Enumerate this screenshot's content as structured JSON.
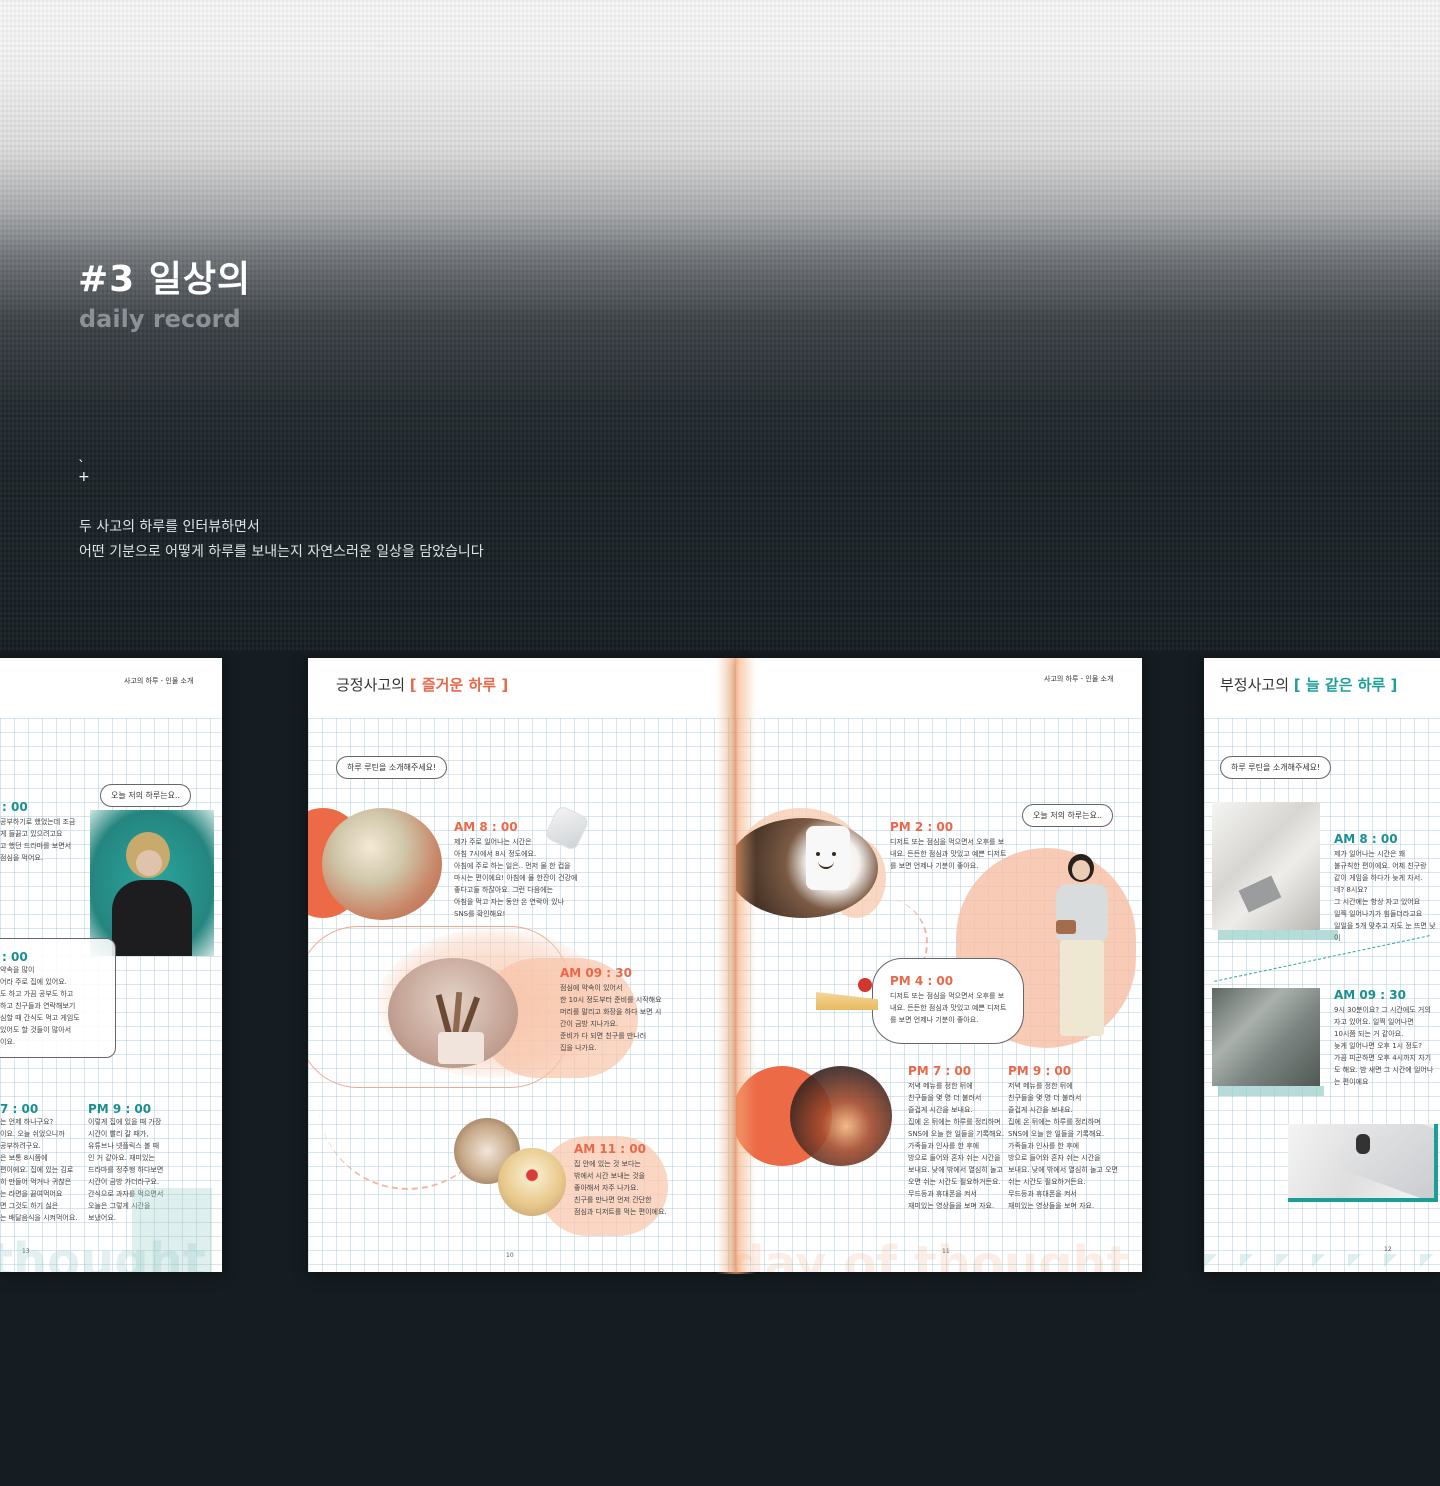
{
  "hero": {
    "title": "#3 일상의",
    "subtitle": "daily record",
    "description_line1": "두 사고의 하루를 인터뷰하면서",
    "description_line2": "어떤 기분으로 어떻게 하루를 보내는지 자연스러운 일상을 담았습니다"
  },
  "left_page": {
    "running_head": "사고의 하루 - 인물 소개",
    "bubble": "오늘 저의 하루는요..",
    "time1": ": 00",
    "text1": "공부하기로 했었는데 조금\n게 들끓고 있으려고요\n고 했던 드라마를 보면서\n점심을 먹어요.",
    "time2": ": 00",
    "text2": "약속을 많이\n어라 주로 집에 있어요.\n도 하고 가끔 공부도 하고\n하고 친구들과 연락해보기\n심할 때 간식도 먹고 게임도\n있어도 할 것들이 많아서\n이요.",
    "time3": "7 : 00",
    "text3": "는 언제 하나구요?\n이요. 오늘 쉬었으니까\n공부하려구요.\n은 보통 8시쯤에\n편이에요. 집에 있는 김로\n히 만들어 먹거나 귀찮은\n는 라면을 끓여먹어요\n면 그것도 하기 싫은\n는 배달음식을 시켜먹어요.",
    "time4": "PM 9 : 00",
    "text4": "이렇게 집에 있을 때 가장\n시간이 빨리 갈 때가,\n유튜브나 넷플릭스 볼 때\n인 거 같아요. 재미있는\n드라마를 정주행 하다보면\n시간이 금방 가더라구요.\n간식으로 과자를 먹으면서\n오늘은 그렇게 시간을\n보냈어요.",
    "page_number": "13",
    "watermark": "thought"
  },
  "spread_left": {
    "heading_prefix": "긍정사고의",
    "heading_bracket": "[ 즐거운 하루 ]",
    "bubble": "하루 루틴을 소개해주세요!",
    "entries": [
      {
        "time": "AM 8 : 00",
        "text": "제가 주로 일어나는 시간은\n아침 7시에서 8시 정도에요.\n아침에 주로 하는 일은.. 먼저 물 한 컵을\n마시는 편이에요! 아침에 물 한잔이 건강에\n좋다고들 하잖아요. 그런 다음에는\n아침을 먹고 자는 동안 온 연락이 있나\nSNS를 확인해요!"
      },
      {
        "time": "AM 09 : 30",
        "text": "점심에 약속이 있어서\n한 10시 정도부터 준비를 시작해요\n머리를 말리고 화장을 하다 보면 시\n간이 금방 지나가요.\n준비가 다 되면 친구를 만나러\n집을 나가요."
      },
      {
        "time": "AM 11 : 00",
        "text": "집 안에 있는 것 보다는\n밖에서 시간 보내는 것을\n좋아해서 자주 나가요.\n친구를 만나면 먼저 간단한\n점심과 디저트를 먹는 편이에요."
      }
    ],
    "page_number": "10"
  },
  "spread_right": {
    "running_head": "사고의 하루 - 인물 소개",
    "bubble": "오늘 저의 하루는요..",
    "entries": [
      {
        "time": "PM 2 : 00",
        "text": "디저트 또는 점심을 먹으면서 오후를 보\n내요. 든든한 점심과 맛있고 예쁜 디저트\n를 보면 언제나 기분이 좋아요."
      },
      {
        "time": "PM 4 : 00",
        "text": "디저트 또는 점심을 먹으면서 오후를 보\n내요. 든든한 점심과 맛있고 예쁜 디저트\n를 보면 언제나 기분이 좋아요."
      },
      {
        "time": "PM 7 : 00",
        "text": "저녁 메뉴를 정한 뒤에\n친구들을 몇 명 더 불러서\n즐겁게 시간을 보내요.\n집에 온 뒤에는 하루를 정리하며\nSNS에 오늘 한 일들을 기록해요.\n가족들과 인사를 한 후에\n방으로 들어와 혼자 쉬는 시간을\n보내요. 낮에 밖에서 열심히 놀고\n오면 쉬는 시간도 필요하거든요.\n무드등과 휴대폰을 켜서\n재미있는 영상들을 보며 자요."
      },
      {
        "time": "PM 9 : 00",
        "text": "저녁 메뉴를 정한 뒤에\n친구들을 몇 명 더 불러서\n즐겁게 시간을 보내요.\n집에 온 뒤에는 하루를 정리하며\nSNS에 오늘 한 일들을 기록해요.\n가족들과 인사를 한 후에\n방으로 들어와 혼자 쉬는 시간을\n보내요. 낮에 밖에서 열심히 놀고 오면\n쉬는 시간도 필요하거든요.\n무드등과 휴대폰을 켜서\n재미있는 영상들을 보며 자요."
      }
    ],
    "page_number": "11",
    "watermark": "day of thought"
  },
  "right_page": {
    "heading_prefix": "부정사고의",
    "heading_bracket": "[ 늘 같은 하루 ]",
    "bubble": "하루 루틴을 소개해주세요!",
    "entries": [
      {
        "time": "AM 8 : 00",
        "text": "제가 일어나는 시간은 꽤\n불규칙한 편이에요. 어제 친구랑\n같이 게임을 하다가 늦게 자서.\n네? 8시요?\n그 시간에는 항상 자고 있어요\n일찍 일어나기가 힘들더라고요\n일일을 5개 맞추고 자도 눈 뜨면 낮이"
      },
      {
        "time": "AM 09 : 30",
        "text": "9시 30분이요? 그 시간에도 거의\n자고 있어요. 일찍 일어나면\n10시쯤 되는 거 같아요.\n늦게 일어나면 오후 1시 정도?\n가끔 피곤하면 오후 4시까지 자기\n도 해요. 밤 새면 그 시간에 일어나\n는 편이에요"
      }
    ],
    "page_number": "12"
  }
}
